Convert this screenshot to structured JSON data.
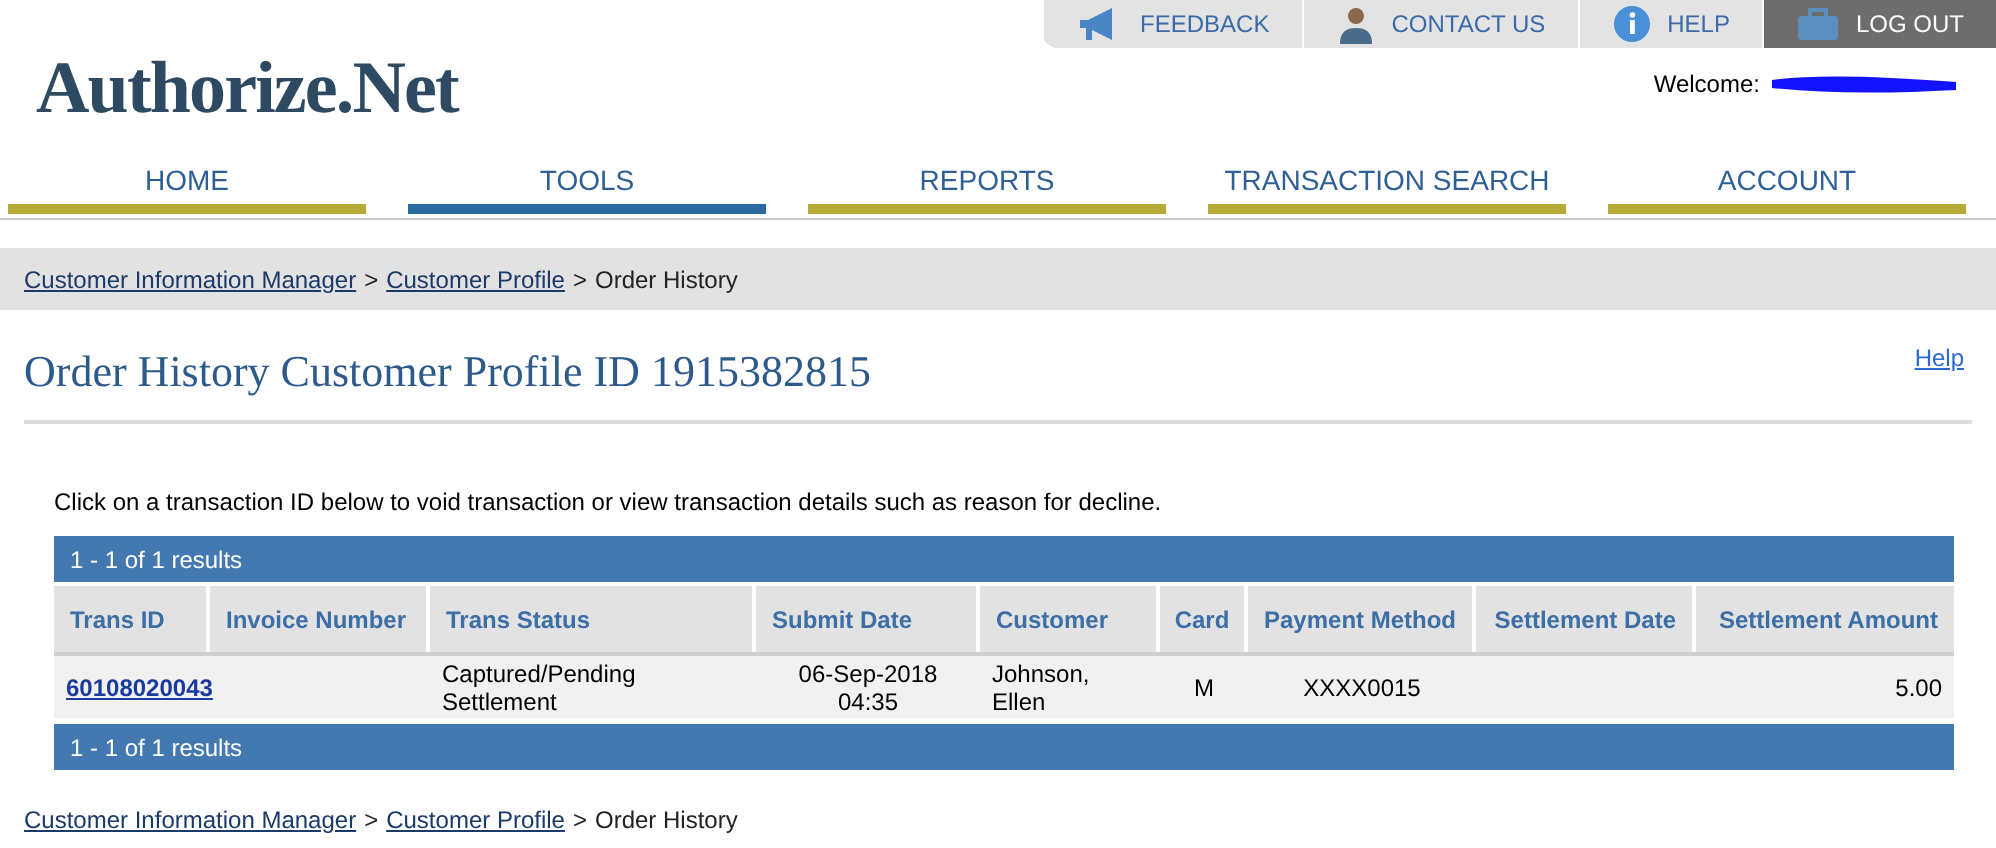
{
  "top_links": [
    {
      "label": "FEEDBACK",
      "kind": "link"
    },
    {
      "label": "CONTACT US",
      "kind": "link"
    },
    {
      "label": "HELP",
      "kind": "link"
    },
    {
      "label": "LOG OUT",
      "kind": "logout"
    }
  ],
  "logo": "Authorize.Net",
  "welcome": "Welcome:",
  "nav": [
    {
      "label": "HOME",
      "selected": false
    },
    {
      "label": "TOOLS",
      "selected": true
    },
    {
      "label": "REPORTS",
      "selected": false
    },
    {
      "label": "TRANSACTION SEARCH",
      "selected": false
    },
    {
      "label": "ACCOUNT",
      "selected": false
    }
  ],
  "breadcrumb": {
    "links": [
      "Customer Information Manager",
      "Customer Profile"
    ],
    "separator": ">",
    "current": "Order History"
  },
  "title": "Order History Customer Profile ID 1915382815",
  "help_link": "Help",
  "instruction": "Click on a transaction ID below to void transaction or view transaction details such as reason for decline.",
  "table": {
    "summary_top": "1 - 1 of 1 results",
    "columns": [
      "Trans ID",
      "Invoice Number",
      "Trans Status",
      "Submit Date",
      "Customer",
      "Card",
      "Payment Method",
      "Settlement Date",
      "Settlement Amount"
    ],
    "rows": [
      {
        "cells": [
          "60108020043",
          "",
          "Captured/Pending Settlement",
          "06-Sep-2018 04:35",
          "Johnson, Ellen",
          "M",
          "XXXX0015",
          "",
          "5.00"
        ]
      }
    ],
    "summary_bottom": "1 - 1 of 1 results"
  },
  "footer_breadcrumb": {
    "links": [
      "Customer Information Manager",
      "Customer Profile"
    ],
    "separator": ">",
    "current": "Order History"
  }
}
